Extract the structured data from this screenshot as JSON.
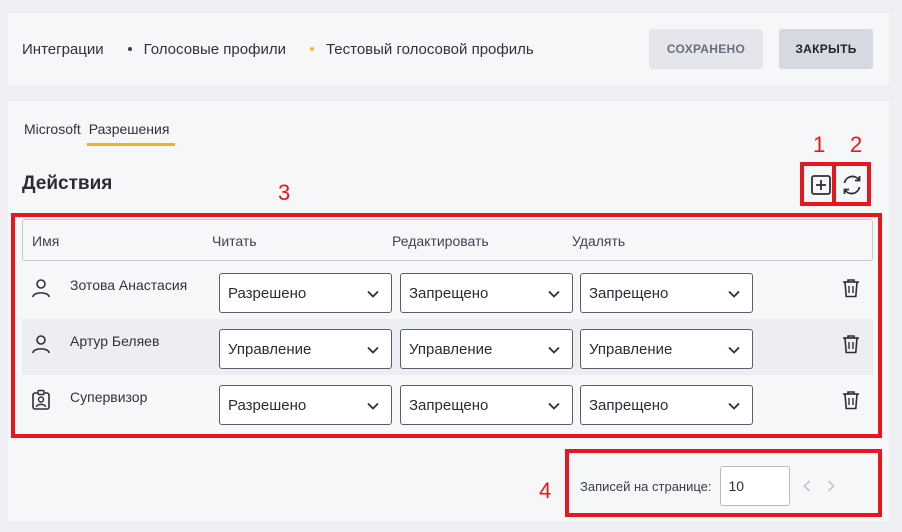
{
  "breadcrumbs": [
    "Интеграции",
    "Голосовые профили",
    "Тестовый голосовой профиль"
  ],
  "header_buttons": {
    "saved": "СОХРАНЕНО",
    "close": "ЗАКРЫТЬ"
  },
  "tabs": [
    {
      "label": "Microsoft",
      "active": false
    },
    {
      "label": "Разрешения",
      "active": true
    }
  ],
  "section_title": "Действия",
  "table": {
    "columns": [
      "Имя",
      "Читать",
      "Редактировать",
      "Удалять"
    ],
    "rows": [
      {
        "icon": "user-icon",
        "name": "Зотова Анастасия",
        "read": "Разрешено",
        "edit": "Запрещено",
        "delete": "Запрещено"
      },
      {
        "icon": "user-icon",
        "name": "Артур Беляев",
        "read": "Управление",
        "edit": "Управление",
        "delete": "Управление"
      },
      {
        "icon": "badge-icon",
        "name": "Супервизор",
        "read": "Разрешено",
        "edit": "Запрещено",
        "delete": "Запрещено"
      }
    ]
  },
  "pagination": {
    "label": "Записей на странице:",
    "page_size": "10"
  },
  "annotations": [
    "1",
    "2",
    "3",
    "4"
  ],
  "colors": {
    "accent": "#f0b323",
    "annotation": "#e8161e"
  }
}
